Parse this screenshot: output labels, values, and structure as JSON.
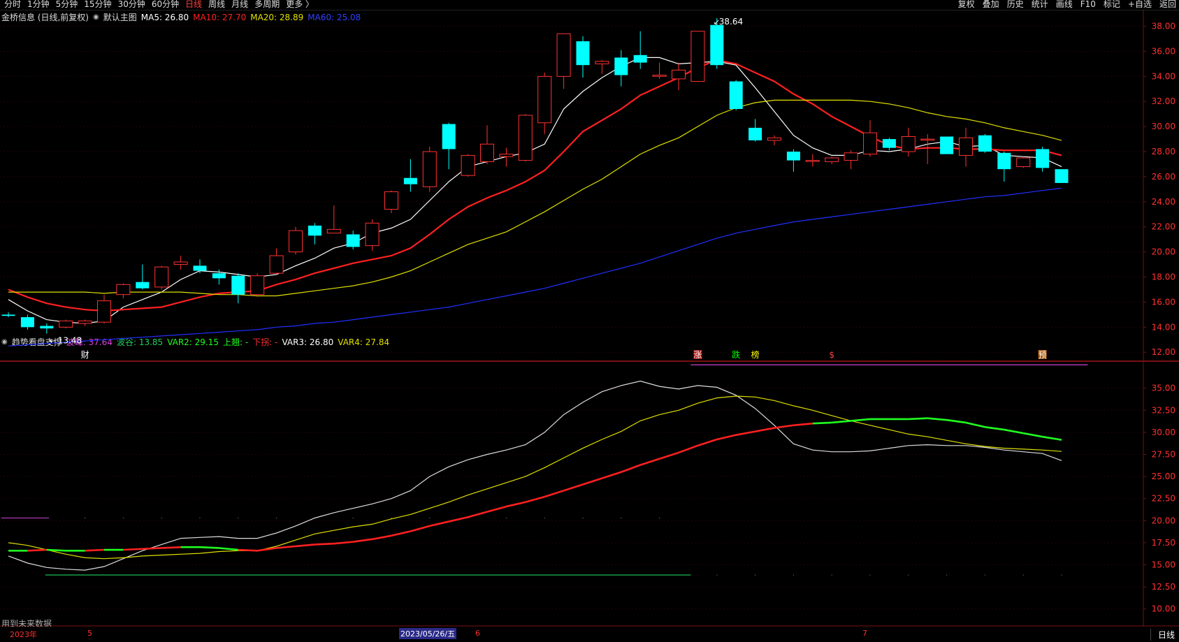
{
  "toolbar": {
    "period_tabs": [
      "分时",
      "1分钟",
      "5分钟",
      "15分钟",
      "30分钟",
      "60分钟",
      "日线",
      "周线",
      "月线",
      "多周期",
      "更多 〉"
    ],
    "active_tab": "日线",
    "right_tools": [
      "复权",
      "叠加",
      "历史",
      "统计",
      "画线",
      "F10",
      "+自选",
      "返回"
    ],
    "mark_label": "标记"
  },
  "main_header": {
    "stock": "金桥信息 (日线,前复权)",
    "template": "默认主图",
    "ma5": "MA5: 26.80",
    "ma10": "MA10: 27.70",
    "ma20": "MA20: 28.89",
    "ma60": "MA60: 25.08"
  },
  "sub_header": {
    "name": "趋势看盘支撑",
    "peak": "波峰: 37.64",
    "trough": "波谷: 13.85",
    "var2": "VAR2: 29.15",
    "up": "上翘: -",
    "down": "下拐: -",
    "var3": "VAR3: 26.80",
    "var4": "VAR4: 27.84"
  },
  "colors": {
    "up_candle": "#ff3232",
    "down_candle": "#00ffff",
    "ma5": "#ffffff",
    "ma10": "#ff2020",
    "ma20": "#e0e000",
    "ma60": "#2030ff",
    "grid": "#7a1010"
  },
  "chart_data": [
    {
      "type": "candlestick",
      "title": "金桥信息 (日线,前复权)",
      "y_ticks": [
        "12.00",
        "14.00",
        "16.00",
        "18.00",
        "20.00",
        "22.00",
        "24.00",
        "26.00",
        "28.00",
        "30.00",
        "32.00",
        "34.00",
        "36.00",
        "38.00"
      ],
      "ylim": [
        11.4,
        39.2
      ],
      "annotations": {
        "high_label": "38.64",
        "low_label": "13.48"
      },
      "event_marks": [
        {
          "index": 4,
          "text": "财"
        },
        {
          "index": 36,
          "text": "涨"
        },
        {
          "index": 38,
          "text": "跌"
        },
        {
          "index": 39,
          "text": "榜"
        },
        {
          "index": 43,
          "text": "$"
        },
        {
          "index": 54,
          "text": "预"
        }
      ],
      "candles": [
        {
          "o": 15.0,
          "h": 15.2,
          "l": 14.8,
          "c": 14.9
        },
        {
          "o": 14.8,
          "h": 15.0,
          "l": 13.8,
          "c": 14.0
        },
        {
          "o": 14.1,
          "h": 14.3,
          "l": 13.48,
          "c": 13.9
        },
        {
          "o": 14.0,
          "h": 14.6,
          "l": 13.9,
          "c": 14.5
        },
        {
          "o": 14.3,
          "h": 14.6,
          "l": 14.1,
          "c": 14.5
        },
        {
          "o": 14.4,
          "h": 16.6,
          "l": 14.3,
          "c": 16.1
        },
        {
          "o": 16.6,
          "h": 17.5,
          "l": 16.3,
          "c": 17.4
        },
        {
          "o": 17.6,
          "h": 19.0,
          "l": 17.0,
          "c": 17.1
        },
        {
          "o": 17.2,
          "h": 18.9,
          "l": 17.0,
          "c": 18.8
        },
        {
          "o": 19.0,
          "h": 19.7,
          "l": 18.6,
          "c": 19.2
        },
        {
          "o": 18.9,
          "h": 19.4,
          "l": 18.3,
          "c": 18.5
        },
        {
          "o": 18.3,
          "h": 18.6,
          "l": 17.4,
          "c": 17.9
        },
        {
          "o": 18.1,
          "h": 18.3,
          "l": 15.9,
          "c": 16.6
        },
        {
          "o": 16.6,
          "h": 18.3,
          "l": 16.4,
          "c": 18.1
        },
        {
          "o": 18.3,
          "h": 20.3,
          "l": 18.2,
          "c": 19.7
        },
        {
          "o": 20.0,
          "h": 22.0,
          "l": 19.8,
          "c": 21.7
        },
        {
          "o": 22.1,
          "h": 22.3,
          "l": 20.6,
          "c": 21.3
        },
        {
          "o": 21.5,
          "h": 23.7,
          "l": 21.5,
          "c": 21.8
        },
        {
          "o": 21.4,
          "h": 21.7,
          "l": 20.2,
          "c": 20.4
        },
        {
          "o": 20.5,
          "h": 22.6,
          "l": 20.1,
          "c": 22.3
        },
        {
          "o": 23.4,
          "h": 24.9,
          "l": 23.1,
          "c": 24.8
        },
        {
          "o": 25.9,
          "h": 27.4,
          "l": 24.8,
          "c": 25.4
        },
        {
          "o": 25.2,
          "h": 28.4,
          "l": 24.8,
          "c": 28.0
        },
        {
          "o": 30.2,
          "h": 30.3,
          "l": 26.6,
          "c": 28.2
        },
        {
          "o": 26.1,
          "h": 27.8,
          "l": 26.0,
          "c": 27.7
        },
        {
          "o": 27.2,
          "h": 30.1,
          "l": 27.0,
          "c": 28.6
        },
        {
          "o": 27.6,
          "h": 28.3,
          "l": 26.8,
          "c": 27.8
        },
        {
          "o": 27.3,
          "h": 31.0,
          "l": 27.2,
          "c": 30.9
        },
        {
          "o": 30.3,
          "h": 34.3,
          "l": 29.4,
          "c": 34.0
        },
        {
          "o": 34.0,
          "h": 37.4,
          "l": 33.0,
          "c": 37.4
        },
        {
          "o": 36.8,
          "h": 37.2,
          "l": 33.9,
          "c": 34.9
        },
        {
          "o": 35.0,
          "h": 35.3,
          "l": 34.2,
          "c": 35.2
        },
        {
          "o": 35.5,
          "h": 36.1,
          "l": 33.2,
          "c": 34.1
        },
        {
          "o": 35.7,
          "h": 37.6,
          "l": 34.6,
          "c": 35.1
        },
        {
          "o": 34.0,
          "h": 35.1,
          "l": 33.8,
          "c": 34.1
        },
        {
          "o": 33.8,
          "h": 35.1,
          "l": 32.9,
          "c": 34.5
        },
        {
          "o": 33.6,
          "h": 37.6,
          "l": 33.6,
          "c": 37.6
        },
        {
          "o": 38.1,
          "h": 38.64,
          "l": 34.6,
          "c": 34.9
        },
        {
          "o": 33.6,
          "h": 33.7,
          "l": 31.3,
          "c": 31.4
        },
        {
          "o": 29.9,
          "h": 30.6,
          "l": 28.8,
          "c": 28.9
        },
        {
          "o": 28.9,
          "h": 29.3,
          "l": 28.5,
          "c": 29.1
        },
        {
          "o": 28.0,
          "h": 28.2,
          "l": 26.4,
          "c": 27.3
        },
        {
          "o": 27.3,
          "h": 27.8,
          "l": 26.8,
          "c": 27.3
        },
        {
          "o": 27.2,
          "h": 27.6,
          "l": 27.0,
          "c": 27.5
        },
        {
          "o": 27.3,
          "h": 28.1,
          "l": 26.6,
          "c": 27.9
        },
        {
          "o": 27.8,
          "h": 30.5,
          "l": 27.6,
          "c": 29.5
        },
        {
          "o": 29.0,
          "h": 29.1,
          "l": 28.1,
          "c": 28.3
        },
        {
          "o": 28.0,
          "h": 29.9,
          "l": 27.6,
          "c": 29.2
        },
        {
          "o": 29.0,
          "h": 29.4,
          "l": 27.0,
          "c": 29.0
        },
        {
          "o": 29.2,
          "h": 29.2,
          "l": 27.8,
          "c": 27.8
        },
        {
          "o": 27.7,
          "h": 29.9,
          "l": 26.8,
          "c": 29.1
        },
        {
          "o": 29.3,
          "h": 29.4,
          "l": 27.9,
          "c": 28.0
        },
        {
          "o": 27.9,
          "h": 28.0,
          "l": 25.6,
          "c": 26.6
        },
        {
          "o": 26.8,
          "h": 27.6,
          "l": 26.7,
          "c": 27.5
        },
        {
          "o": 28.2,
          "h": 28.4,
          "l": 26.4,
          "c": 26.7
        },
        {
          "o": 26.6,
          "h": 26.6,
          "l": 25.5,
          "c": 25.5
        }
      ],
      "series": [
        {
          "name": "MA5",
          "values": [
            16.2,
            15.3,
            14.6,
            14.4,
            14.3,
            14.5,
            15.6,
            16.2,
            16.8,
            17.8,
            18.5,
            18.4,
            18.2,
            18.0,
            18.2,
            18.9,
            19.5,
            20.3,
            20.7,
            21.5,
            21.9,
            22.6,
            24.1,
            25.6,
            26.8,
            27.2,
            27.6,
            27.9,
            28.6,
            31.4,
            32.8,
            33.9,
            34.8,
            35.5,
            35.5,
            35.0,
            35.1,
            35.2,
            34.9,
            33.1,
            31.2,
            29.3,
            28.3,
            27.7,
            27.7,
            28.1,
            28.0,
            28.2,
            28.6,
            28.8,
            28.4,
            28.5,
            27.7,
            27.6,
            27.5,
            26.8
          ]
        },
        {
          "name": "MA10",
          "values": [
            17.0,
            16.4,
            15.9,
            15.6,
            15.4,
            15.3,
            15.4,
            15.5,
            15.6,
            16.0,
            16.4,
            16.7,
            16.8,
            16.9,
            17.4,
            17.8,
            18.3,
            18.7,
            19.1,
            19.4,
            19.7,
            20.3,
            21.4,
            22.6,
            23.6,
            24.3,
            24.9,
            25.6,
            26.5,
            28.0,
            29.6,
            30.5,
            31.4,
            32.5,
            33.2,
            33.9,
            34.7,
            35.3,
            35.0,
            34.3,
            33.6,
            32.6,
            31.8,
            30.8,
            30.0,
            29.2,
            28.5,
            28.2,
            28.3,
            28.3,
            28.2,
            28.2,
            28.1,
            28.1,
            28.1,
            27.7
          ]
        },
        {
          "name": "MA20",
          "values": [
            16.8,
            16.8,
            16.8,
            16.8,
            16.8,
            16.7,
            16.8,
            16.8,
            16.8,
            16.8,
            16.7,
            16.6,
            16.6,
            16.5,
            16.5,
            16.7,
            16.9,
            17.1,
            17.3,
            17.6,
            18.0,
            18.5,
            19.2,
            19.9,
            20.6,
            21.1,
            21.6,
            22.4,
            23.2,
            24.1,
            25.0,
            25.8,
            26.8,
            27.8,
            28.5,
            29.1,
            30.0,
            30.9,
            31.5,
            31.9,
            32.1,
            32.1,
            32.1,
            32.1,
            32.1,
            32.0,
            31.8,
            31.5,
            31.1,
            30.8,
            30.6,
            30.3,
            29.9,
            29.6,
            29.3,
            28.9
          ]
        },
        {
          "name": "MA60",
          "values": [
            12.5,
            12.6,
            12.7,
            12.8,
            12.9,
            13.0,
            13.1,
            13.2,
            13.3,
            13.4,
            13.5,
            13.6,
            13.7,
            13.8,
            14.0,
            14.1,
            14.3,
            14.4,
            14.6,
            14.8,
            15.0,
            15.2,
            15.4,
            15.6,
            15.9,
            16.2,
            16.5,
            16.8,
            17.1,
            17.5,
            17.9,
            18.3,
            18.7,
            19.1,
            19.6,
            20.1,
            20.6,
            21.1,
            21.5,
            21.8,
            22.1,
            22.4,
            22.6,
            22.8,
            23.0,
            23.2,
            23.4,
            23.6,
            23.8,
            24.0,
            24.2,
            24.4,
            24.5,
            24.7,
            24.9,
            25.08
          ]
        }
      ]
    },
    {
      "type": "line",
      "title": "趋势看盘支撑",
      "y_ticks": [
        "10.00",
        "12.50",
        "15.00",
        "17.50",
        "20.00",
        "22.50",
        "25.00",
        "27.50",
        "30.00",
        "32.50",
        "35.00"
      ],
      "ylim": [
        8.0,
        37.9
      ],
      "peak_line": {
        "value": 37.64,
        "from_index": 36,
        "to_index": 56
      },
      "trough_line": {
        "value": 13.85,
        "from_index": 2,
        "to_index": 36
      },
      "left_marker_value": 20.3,
      "series": [
        {
          "name": "VAR2",
          "values": [
            16.6,
            16.6,
            16.7,
            16.6,
            16.6,
            16.7,
            16.7,
            16.8,
            16.9,
            17.0,
            17.0,
            16.9,
            16.7,
            16.6,
            16.9,
            17.1,
            17.3,
            17.4,
            17.6,
            17.9,
            18.3,
            18.8,
            19.4,
            19.9,
            20.4,
            21.0,
            21.6,
            22.1,
            22.7,
            23.4,
            24.1,
            24.8,
            25.5,
            26.3,
            27.0,
            27.7,
            28.5,
            29.2,
            29.7,
            30.1,
            30.5,
            30.8,
            31.0,
            31.1,
            31.3,
            31.5,
            31.5,
            31.5,
            31.6,
            31.4,
            31.1,
            30.6,
            30.3,
            29.9,
            29.5,
            29.15
          ]
        },
        {
          "name": "VAR3",
          "values": [
            16.0,
            15.2,
            14.7,
            14.5,
            14.4,
            14.8,
            15.7,
            16.6,
            17.3,
            18.0,
            18.1,
            18.2,
            18.0,
            18.0,
            18.6,
            19.4,
            20.3,
            20.9,
            21.4,
            21.9,
            22.5,
            23.4,
            25.0,
            26.1,
            26.9,
            27.5,
            28.0,
            28.6,
            30.0,
            32.0,
            33.4,
            34.6,
            35.3,
            35.8,
            35.2,
            34.9,
            35.3,
            35.1,
            34.2,
            32.7,
            30.8,
            28.7,
            28.0,
            27.8,
            27.8,
            27.9,
            28.2,
            28.5,
            28.6,
            28.5,
            28.5,
            28.3,
            28.0,
            27.8,
            27.6,
            26.8
          ]
        },
        {
          "name": "VAR4",
          "values": [
            17.5,
            17.2,
            16.7,
            16.2,
            15.8,
            15.7,
            15.8,
            16.0,
            16.1,
            16.2,
            16.3,
            16.5,
            16.6,
            16.6,
            17.1,
            17.8,
            18.5,
            18.9,
            19.3,
            19.6,
            20.2,
            20.7,
            21.4,
            22.1,
            22.9,
            23.6,
            24.3,
            25.0,
            26.0,
            27.1,
            28.2,
            29.2,
            30.1,
            31.3,
            32.0,
            32.5,
            33.3,
            33.9,
            34.1,
            34.0,
            33.6,
            33.0,
            32.5,
            31.9,
            31.3,
            30.8,
            30.3,
            29.8,
            29.5,
            29.1,
            28.7,
            28.4,
            28.2,
            28.1,
            28.0,
            27.84
          ]
        }
      ]
    }
  ],
  "axis_bottom": {
    "year": "2023年",
    "m5": "5",
    "date": "2023/05/26/五",
    "m6": "6",
    "m7": "7"
  },
  "hint": "用到未来数据",
  "period_button": "日线"
}
